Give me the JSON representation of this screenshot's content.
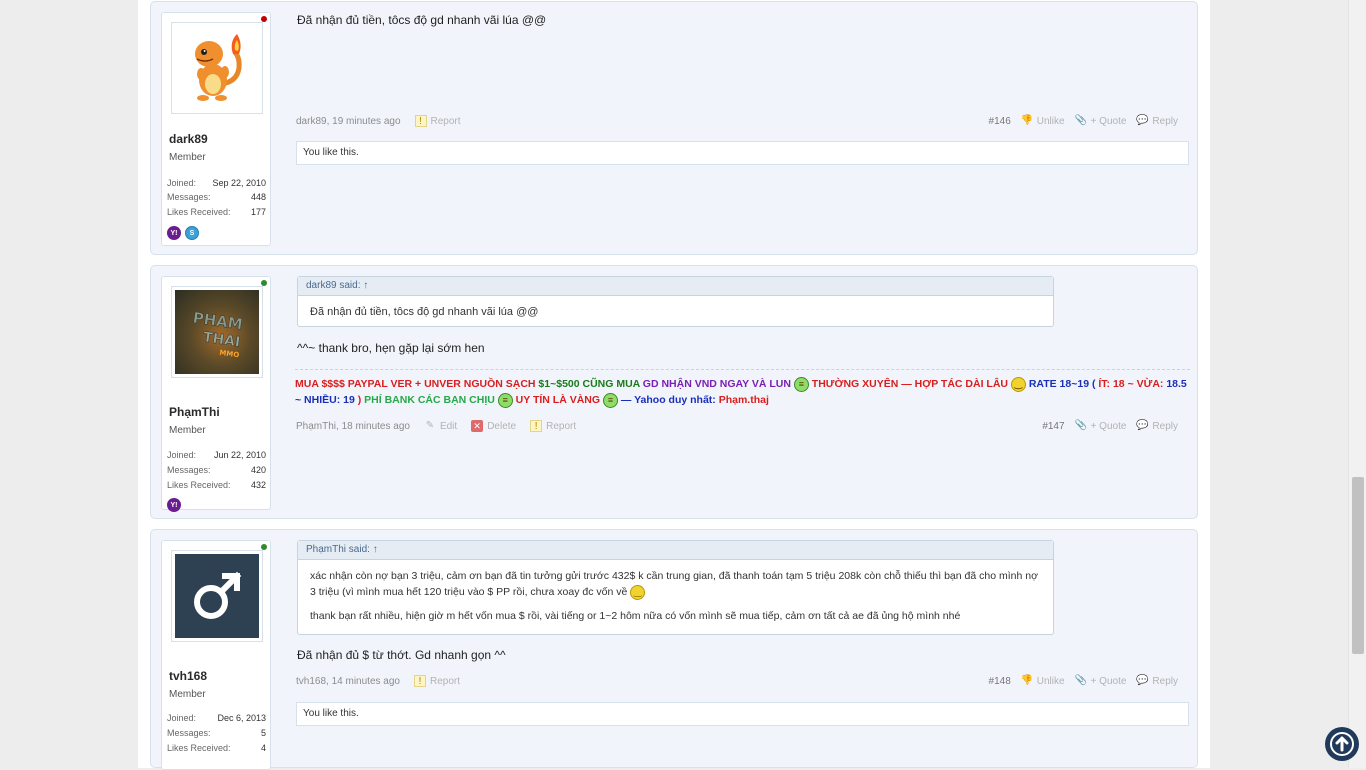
{
  "posts": [
    {
      "username": "dark89",
      "title": "Member",
      "stats": {
        "joined_label": "Joined:",
        "joined": "Sep 22, 2010",
        "messages_label": "Messages:",
        "messages": "448",
        "likes_label": "Likes Received:",
        "likes": "177"
      },
      "message": "Đã nhận đủ tiền, tôcs độ gd nhanh vãi lúa @@",
      "meta": {
        "author": "dark89",
        "time": ", 19 minutes ago",
        "report": "Report",
        "number": "#146",
        "unlike": "Unlike",
        "quote": "+ Quote",
        "reply": "Reply"
      },
      "likes_text": "You like this."
    },
    {
      "username": "PhạmThi",
      "title": "Member",
      "stats": {
        "joined_label": "Joined:",
        "joined": "Jun 22, 2010",
        "messages_label": "Messages:",
        "messages": "420",
        "likes_label": "Likes Received:",
        "likes": "432"
      },
      "avatar_text": "PHAM THAI",
      "quote_head": "dark89 said: ↑",
      "quote_body": "Đã nhận đủ tiền, tôcs độ gd nhanh vãi lúa @@",
      "message": "^^~ thank bro, hẹn gặp lại sớm hen",
      "signature": {
        "s1": "MUA $$$$ PAYPAL VER + UNVER NGUỒN SẠCH",
        "s2": " $1~$500 CŨNG MUA",
        "s3": " GD NHẬN VND NGAY VÀ LUN",
        "s4": " THƯỜNG XUYÊN — HỢP TÁC DÀI LÂU",
        "s5": " RATE 18~19 (",
        "s6": " ÍT: 18 ~ VỪA:",
        "s7": " 18.5 ~ NHIỀU: 19",
        "s8": " )",
        "s9": " PHÍ BANK CÁC BẠN CHỊU",
        "s10": " UY TÍN LÀ VÀNG",
        "s11": " — Yahoo duy nhất:",
        "s12": " Phạm.thaj"
      },
      "meta": {
        "author": "PhạmThi",
        "time": ", 18 minutes ago",
        "edit": "Edit",
        "delete": "Delete",
        "report": "Report",
        "number": "#147",
        "quote": "+ Quote",
        "reply": "Reply"
      }
    },
    {
      "username": "tvh168",
      "title": "Member",
      "stats": {
        "joined_label": "Joined:",
        "joined": "Dec 6, 2013",
        "messages_label": "Messages:",
        "messages": "5",
        "likes_label": "Likes Received:",
        "likes": "4"
      },
      "quote_head": "PhạmThi said: ↑",
      "quote_p1": "xác nhận còn nợ bạn 3 triệu, cảm ơn bạn đã tin tưởng gửi trước 432$ k cần trung gian, đã thanh toán tạm 5 triệu 208k còn chỗ thiếu thì bạn đã cho mình nợ 3 triệu (vì mình mua hết 120 triệu vào $ PP rồi, chưa xoay đc vốn về",
      "quote_p2": "thank bạn rất nhiều, hiện giờ m hết vốn mua $ rồi, vài tiếng or 1~2 hôm nữa có vốn mình sẽ mua tiếp, cảm ơn tất cả ae đã ủng hộ mình nhé",
      "message": "Đã nhận đủ $ từ thớt. Gd nhanh gọn ^^",
      "meta": {
        "author": "tvh168",
        "time": ", 14 minutes ago",
        "report": "Report",
        "number": "#148",
        "unlike": "Unlike",
        "quote": "+ Quote",
        "reply": "Reply"
      },
      "likes_text": "You like this."
    }
  ],
  "colors": {
    "red": "#d81e1e",
    "green": "#1a7a1a",
    "purple": "#7a1fb5",
    "blue": "#1a2fb8",
    "bright_green": "#27a84a"
  }
}
